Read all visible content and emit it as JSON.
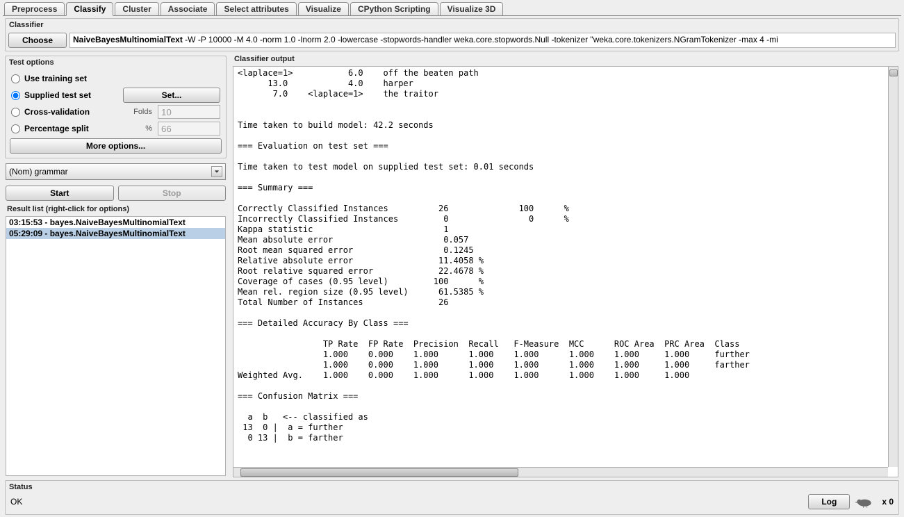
{
  "tabs": [
    "Preprocess",
    "Classify",
    "Cluster",
    "Associate",
    "Select attributes",
    "Visualize",
    "CPython Scripting",
    "Visualize 3D"
  ],
  "selected_tab": "Classify",
  "classifier_section": {
    "title": "Classifier",
    "choose_label": "Choose",
    "algorithm_name": "NaiveBayesMultinomialText",
    "algorithm_args": " -W -P 10000 -M 4.0 -norm 1.0 -lnorm 2.0 -lowercase -stopwords-handler weka.core.stopwords.Null -tokenizer \"weka.core.tokenizers.NGramTokenizer -max 4 -mi"
  },
  "test_options": {
    "title": "Test options",
    "use_training": "Use training set",
    "supplied_test": "Supplied test set",
    "set_btn": "Set...",
    "cross_validation": "Cross-validation",
    "folds_label": "Folds",
    "folds_value": "10",
    "percentage_split": "Percentage split",
    "pct_label": "%",
    "pct_value": "66",
    "more_options": "More options...",
    "selected_option": "supplied"
  },
  "attribute_combo": "(Nom) grammar",
  "start_btn": "Start",
  "stop_btn": "Stop",
  "result_list": {
    "title": "Result list (right-click for options)",
    "items": [
      "03:15:53 - bayes.NaiveBayesMultinomialText",
      "05:29:09 - bayes.NaiveBayesMultinomialText"
    ],
    "selected_index": 1
  },
  "output_title": "Classifier output",
  "output_text": "<laplace=1>           6.0    off the beaten path\n      13.0            4.0    harper\n       7.0    <laplace=1>    the traitor\n\n\nTime taken to build model: 42.2 seconds\n\n=== Evaluation on test set ===\n\nTime taken to test model on supplied test set: 0.01 seconds\n\n=== Summary ===\n\nCorrectly Classified Instances          26              100      %\nIncorrectly Classified Instances         0                0      %\nKappa statistic                          1     \nMean absolute error                      0.057 \nRoot mean squared error                  0.1245\nRelative absolute error                 11.4058 %\nRoot relative squared error             22.4678 %\nCoverage of cases (0.95 level)         100      %\nMean rel. region size (0.95 level)      61.5385 %\nTotal Number of Instances               26     \n\n=== Detailed Accuracy By Class ===\n\n                 TP Rate  FP Rate  Precision  Recall   F-Measure  MCC      ROC Area  PRC Area  Class\n                 1.000    0.000    1.000      1.000    1.000      1.000    1.000     1.000     further\n                 1.000    0.000    1.000      1.000    1.000      1.000    1.000     1.000     farther\nWeighted Avg.    1.000    0.000    1.000      1.000    1.000      1.000    1.000     1.000     \n\n=== Confusion Matrix ===\n\n  a  b   <-- classified as\n 13  0 |  a = further\n  0 13 |  b = farther\n",
  "status": {
    "title": "Status",
    "text": "OK",
    "log_btn": "Log",
    "count": "x 0"
  }
}
